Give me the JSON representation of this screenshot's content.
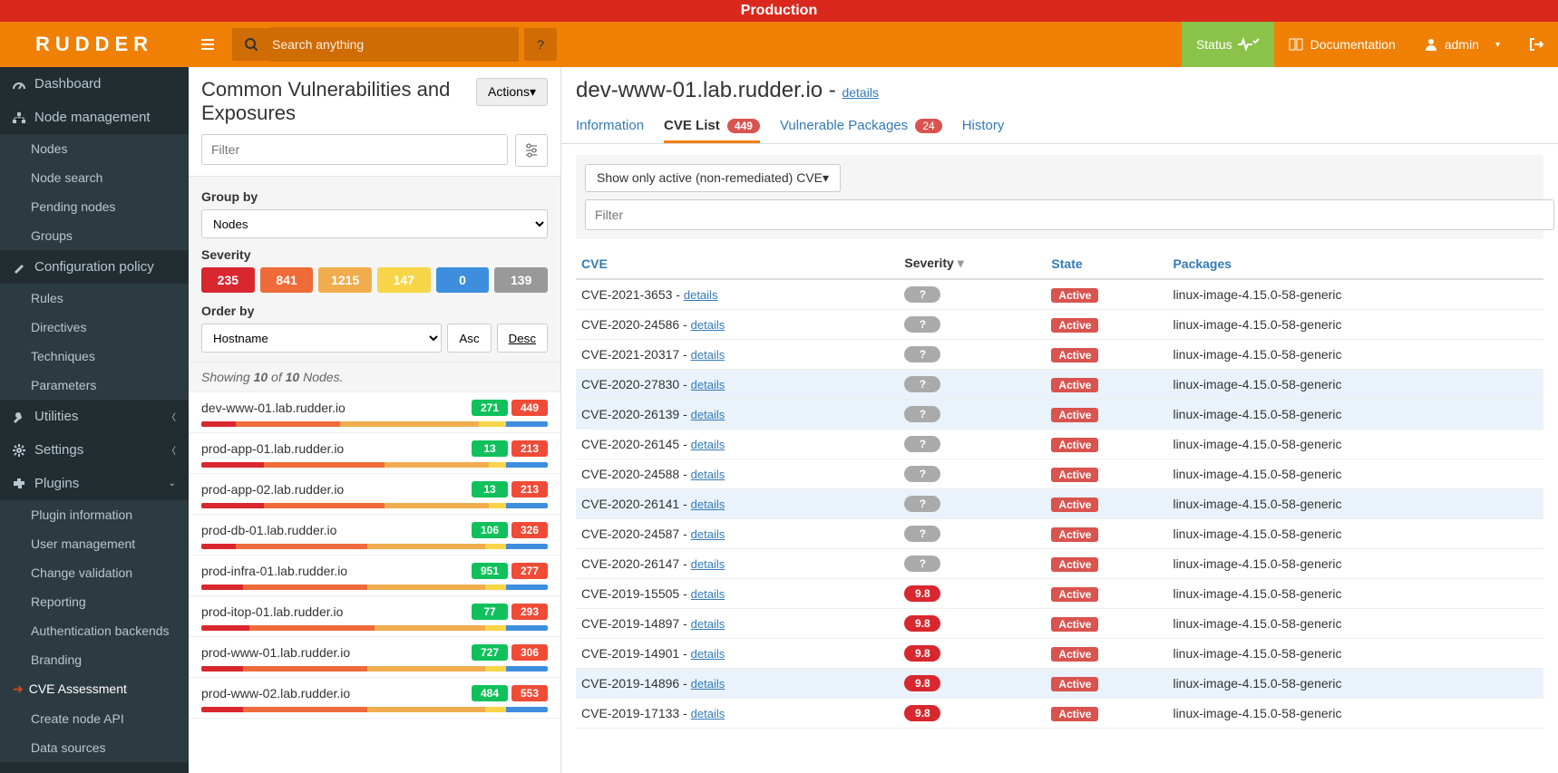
{
  "env_banner": "Production",
  "brand": "RUDDER",
  "search_placeholder": "Search anything",
  "header": {
    "status": "Status",
    "docs": "Documentation",
    "user": "admin"
  },
  "sidebar": {
    "dashboard": "Dashboard",
    "node_mgmt": "Node management",
    "node_mgmt_items": [
      "Nodes",
      "Node search",
      "Pending nodes",
      "Groups"
    ],
    "config": "Configuration policy",
    "config_items": [
      "Rules",
      "Directives",
      "Techniques",
      "Parameters"
    ],
    "utilities": "Utilities",
    "settings": "Settings",
    "plugins": "Plugins",
    "plugin_items": [
      "Plugin information",
      "User management",
      "Change validation",
      "Reporting",
      "Authentication backends",
      "Branding",
      "CVE Assessment",
      "Create node API",
      "Data sources"
    ],
    "active_plugin": "CVE Assessment"
  },
  "left": {
    "title": "Common Vulnerabilities and Exposures",
    "actions": "Actions",
    "filter_placeholder": "Filter",
    "group_by_label": "Group by",
    "group_by_value": "Nodes",
    "severity_label": "Severity",
    "severity_counts": [
      {
        "value": "235",
        "color": "#d9272f"
      },
      {
        "value": "841",
        "color": "#ef6b3a"
      },
      {
        "value": "1215",
        "color": "#f0ad4e"
      },
      {
        "value": "147",
        "color": "#f7d548"
      },
      {
        "value": "0",
        "color": "#3e8ede"
      },
      {
        "value": "139",
        "color": "#999"
      }
    ],
    "order_by_label": "Order by",
    "order_by_value": "Hostname",
    "asc": "Asc",
    "desc": "Desc",
    "showing_pre": "Showing ",
    "showing_a": "10",
    "showing_mid": " of ",
    "showing_b": "10",
    "showing_post": " Nodes.",
    "nodes": [
      {
        "name": "dev-www-01.lab.rudder.io",
        "g": "271",
        "r": "449",
        "bar": [
          [
            "#d9272f",
            10
          ],
          [
            "#ef6b3a",
            30
          ],
          [
            "#f0ad4e",
            40
          ],
          [
            "#f7d548",
            8
          ],
          [
            "#3e8ede",
            12
          ]
        ]
      },
      {
        "name": "prod-app-01.lab.rudder.io",
        "g": "13",
        "r": "213",
        "bar": [
          [
            "#d9272f",
            18
          ],
          [
            "#ef6b3a",
            35
          ],
          [
            "#f0ad4e",
            30
          ],
          [
            "#f7d548",
            5
          ],
          [
            "#3e8ede",
            12
          ]
        ]
      },
      {
        "name": "prod-app-02.lab.rudder.io",
        "g": "13",
        "r": "213",
        "bar": [
          [
            "#d9272f",
            18
          ],
          [
            "#ef6b3a",
            35
          ],
          [
            "#f0ad4e",
            30
          ],
          [
            "#f7d548",
            5
          ],
          [
            "#3e8ede",
            12
          ]
        ]
      },
      {
        "name": "prod-db-01.lab.rudder.io",
        "g": "106",
        "r": "326",
        "bar": [
          [
            "#d9272f",
            10
          ],
          [
            "#ef6b3a",
            38
          ],
          [
            "#f0ad4e",
            34
          ],
          [
            "#f7d548",
            6
          ],
          [
            "#3e8ede",
            12
          ]
        ]
      },
      {
        "name": "prod-infra-01.lab.rudder.io",
        "g": "951",
        "r": "277",
        "bar": [
          [
            "#d9272f",
            12
          ],
          [
            "#ef6b3a",
            36
          ],
          [
            "#f0ad4e",
            34
          ],
          [
            "#f7d548",
            6
          ],
          [
            "#3e8ede",
            12
          ]
        ]
      },
      {
        "name": "prod-itop-01.lab.rudder.io",
        "g": "77",
        "r": "293",
        "bar": [
          [
            "#d9272f",
            14
          ],
          [
            "#ef6b3a",
            36
          ],
          [
            "#f0ad4e",
            32
          ],
          [
            "#f7d548",
            6
          ],
          [
            "#3e8ede",
            12
          ]
        ]
      },
      {
        "name": "prod-www-01.lab.rudder.io",
        "g": "727",
        "r": "306",
        "bar": [
          [
            "#d9272f",
            12
          ],
          [
            "#ef6b3a",
            36
          ],
          [
            "#f0ad4e",
            34
          ],
          [
            "#f7d548",
            6
          ],
          [
            "#3e8ede",
            12
          ]
        ]
      },
      {
        "name": "prod-www-02.lab.rudder.io",
        "g": "484",
        "r": "553",
        "bar": [
          [
            "#d9272f",
            12
          ],
          [
            "#ef6b3a",
            36
          ],
          [
            "#f0ad4e",
            34
          ],
          [
            "#f7d548",
            6
          ],
          [
            "#3e8ede",
            12
          ]
        ]
      }
    ]
  },
  "right": {
    "host": "dev-www-01.lab.rudder.io",
    "details_link": "details",
    "tabs": {
      "info": "Information",
      "cve": "CVE List",
      "cve_count": "449",
      "vuln": "Vulnerable Packages",
      "vuln_count": "24",
      "history": "History"
    },
    "filter_dropdown": "Show only active (non-remediated) CVE",
    "filter_placeholder": "Filter",
    "columns": {
      "cve": "CVE",
      "severity": "Severity",
      "state": "State",
      "packages": "Packages"
    },
    "state_active": "Active",
    "details": "details",
    "pkg": "linux-image-4.15.0-58-generic",
    "rows": [
      {
        "id": "CVE-2021-3653",
        "sev": "?",
        "hl": false
      },
      {
        "id": "CVE-2020-24586",
        "sev": "?",
        "hl": false
      },
      {
        "id": "CVE-2021-20317",
        "sev": "?",
        "hl": false
      },
      {
        "id": "CVE-2020-27830",
        "sev": "?",
        "hl": true
      },
      {
        "id": "CVE-2020-26139",
        "sev": "?",
        "hl": true
      },
      {
        "id": "CVE-2020-26145",
        "sev": "?",
        "hl": false
      },
      {
        "id": "CVE-2020-24588",
        "sev": "?",
        "hl": false
      },
      {
        "id": "CVE-2020-26141",
        "sev": "?",
        "hl": true
      },
      {
        "id": "CVE-2020-24587",
        "sev": "?",
        "hl": false
      },
      {
        "id": "CVE-2020-26147",
        "sev": "?",
        "hl": false
      },
      {
        "id": "CVE-2019-15505",
        "sev": "9.8",
        "hl": false
      },
      {
        "id": "CVE-2019-14897",
        "sev": "9.8",
        "hl": false
      },
      {
        "id": "CVE-2019-14901",
        "sev": "9.8",
        "hl": false
      },
      {
        "id": "CVE-2019-14896",
        "sev": "9.8",
        "hl": true
      },
      {
        "id": "CVE-2019-17133",
        "sev": "9.8",
        "hl": false
      }
    ]
  }
}
